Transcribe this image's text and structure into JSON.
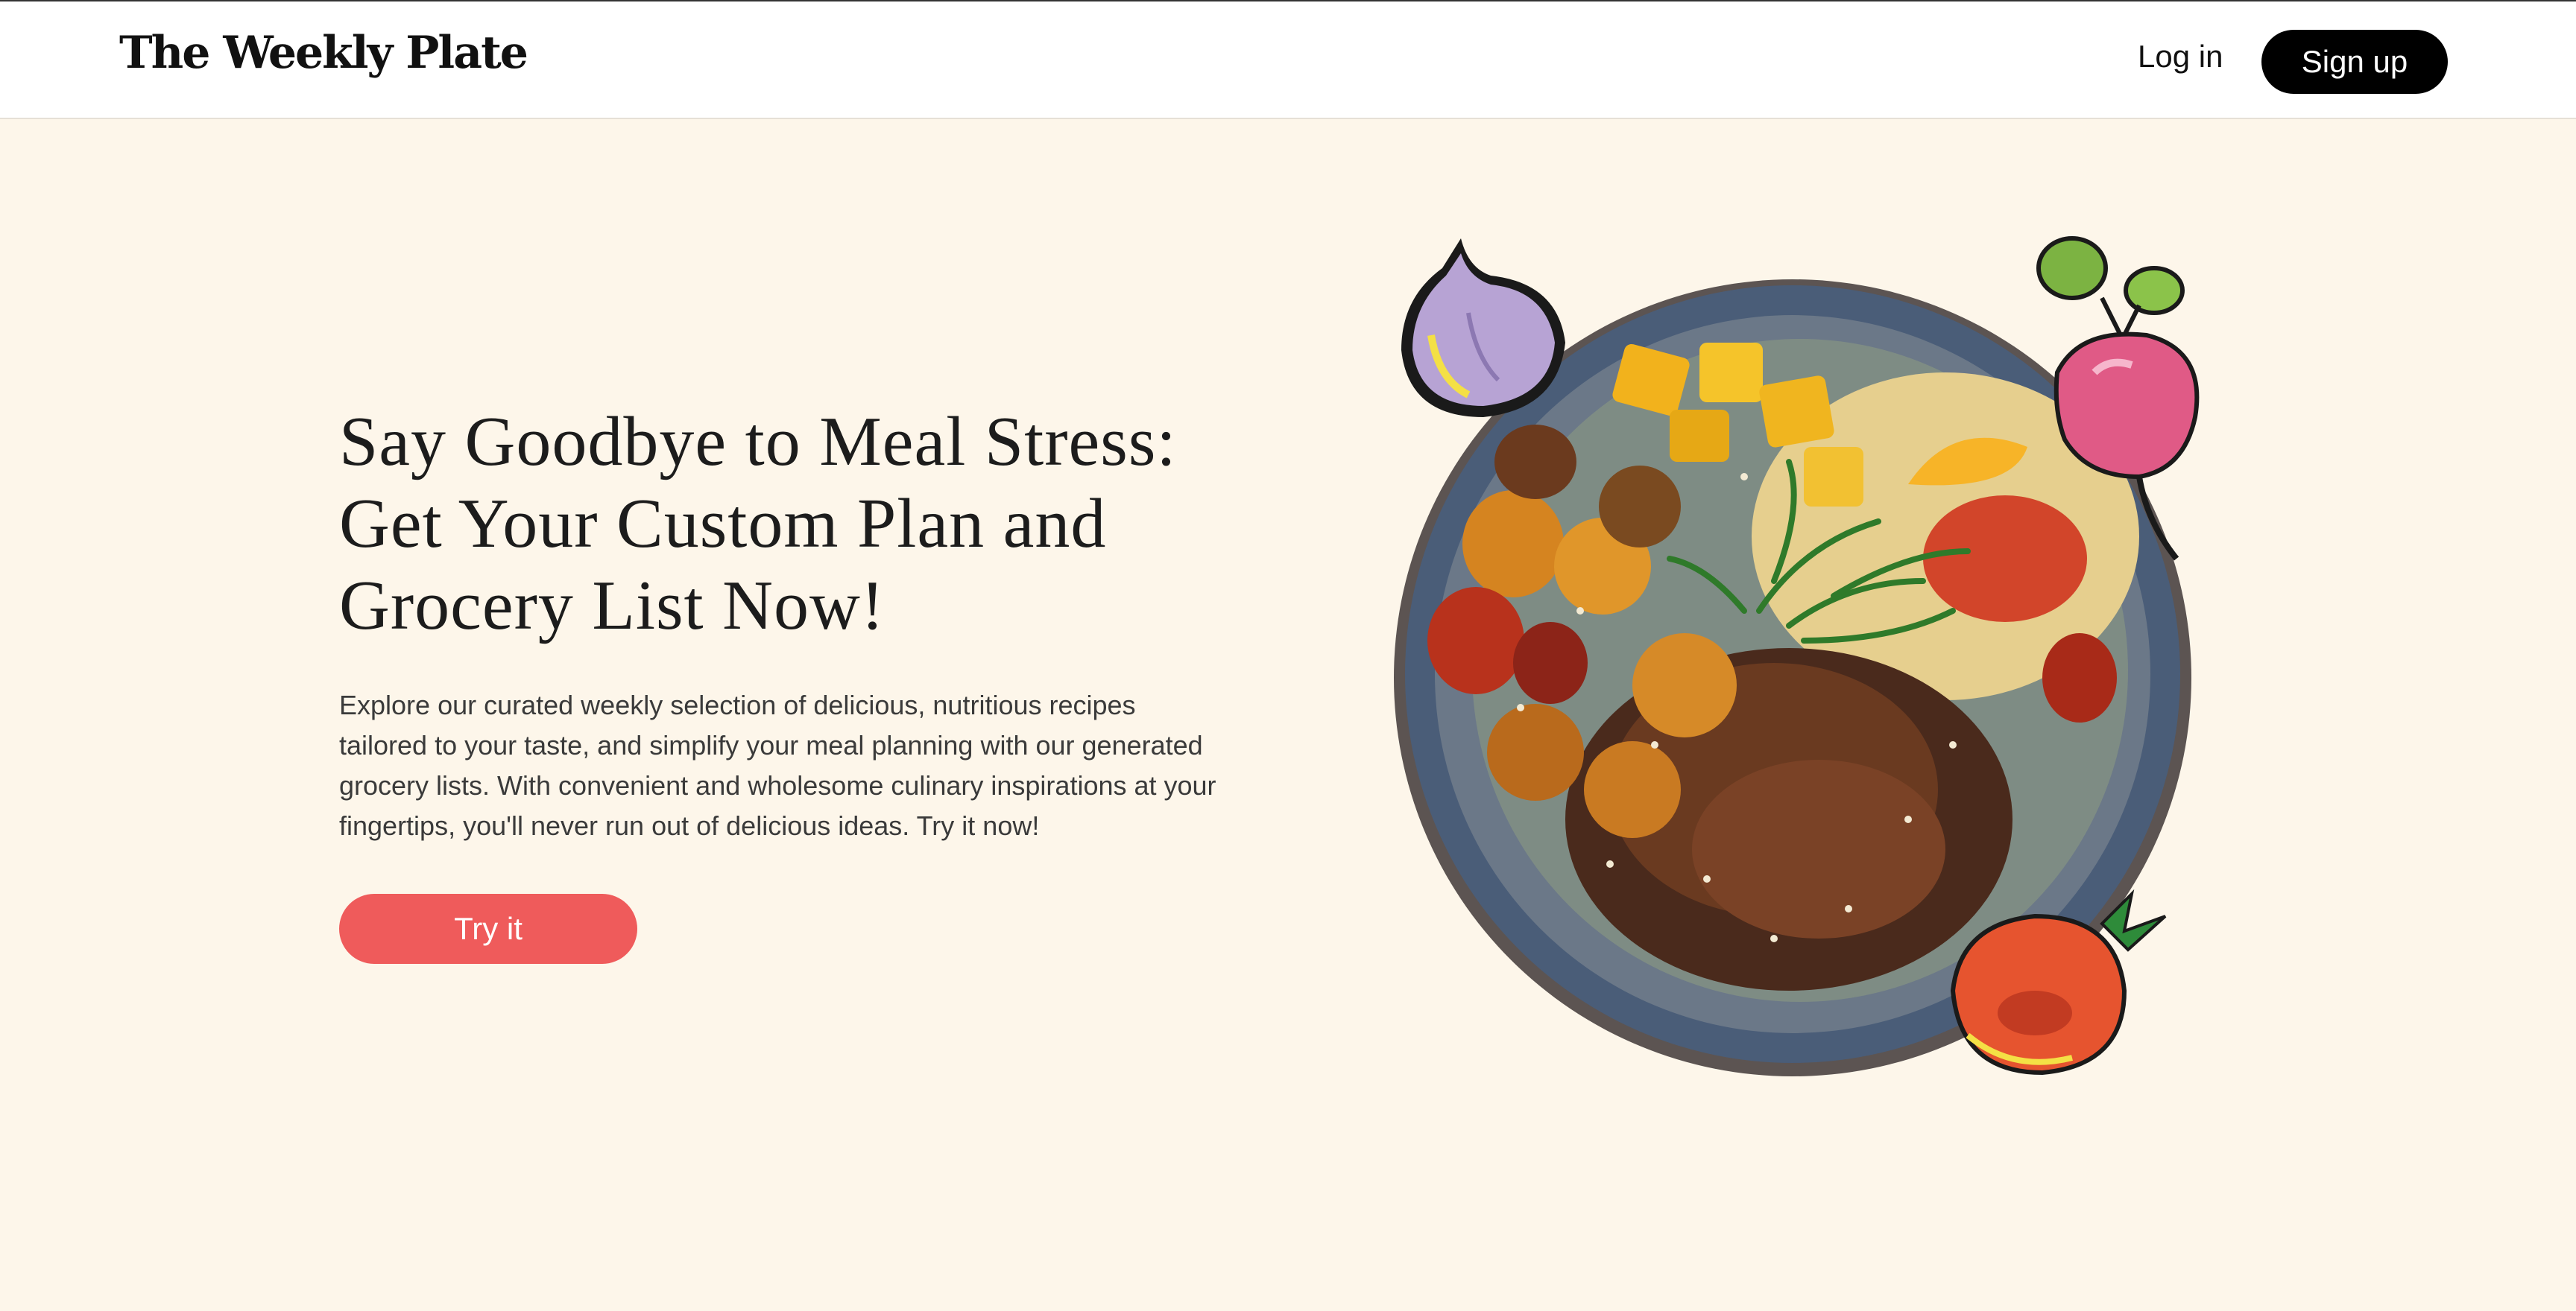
{
  "header": {
    "brand": "The Weekly Plate",
    "login_label": "Log in",
    "signup_label": "Sign up"
  },
  "hero": {
    "title": "Say Goodbye to Meal Stress: Get Your Custom Plan and Grocery List Now!",
    "description": "Explore our curated weekly selection of delicious, nutritious recipes tailored to your taste, and simplify your meal planning with our generated grocery lists. With convenient and wholesome culinary inspirations at your fingertips, you'll never run out of delicious ideas. Try it now!",
    "cta_label": "Try it"
  },
  "colors": {
    "page_background": "#fdf6ea",
    "cta": "#ef5b5b",
    "signup_button": "#000000"
  },
  "illustration": {
    "icons": [
      "onion-icon",
      "radish-icon",
      "tomato-icon",
      "food-bowl-image"
    ]
  }
}
